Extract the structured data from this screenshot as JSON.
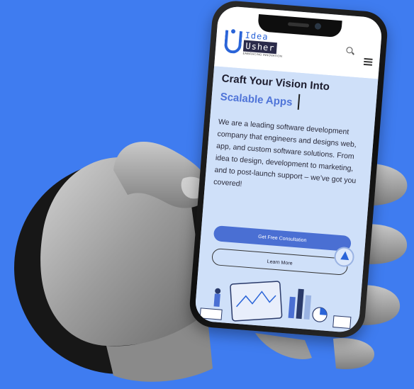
{
  "site": {
    "logo": {
      "word1": "Idea",
      "word2": "Usher",
      "tagline": "EMBRACING INNOVATION"
    },
    "hero": {
      "headline_line1": "Craft Your Vision Into",
      "headline_line2": "Scalable Apps",
      "description": "We are a leading software development company that engineers and designs web, app, and custom software solutions. From idea to design, development to marketing, and to post-launch support – we’ve got you covered!",
      "primary_cta": "Get Free Consultation",
      "secondary_cta": "Learn More"
    }
  },
  "icons": {
    "search": "search-icon",
    "menu": "hamburger-menu-icon",
    "chat": "chat-widget-icon"
  },
  "colors": {
    "background": "#3f7cf0",
    "brand_blue": "#4a6fd3",
    "hero_bg": "#cfe0f9",
    "accent_text": "#4f74d8"
  }
}
